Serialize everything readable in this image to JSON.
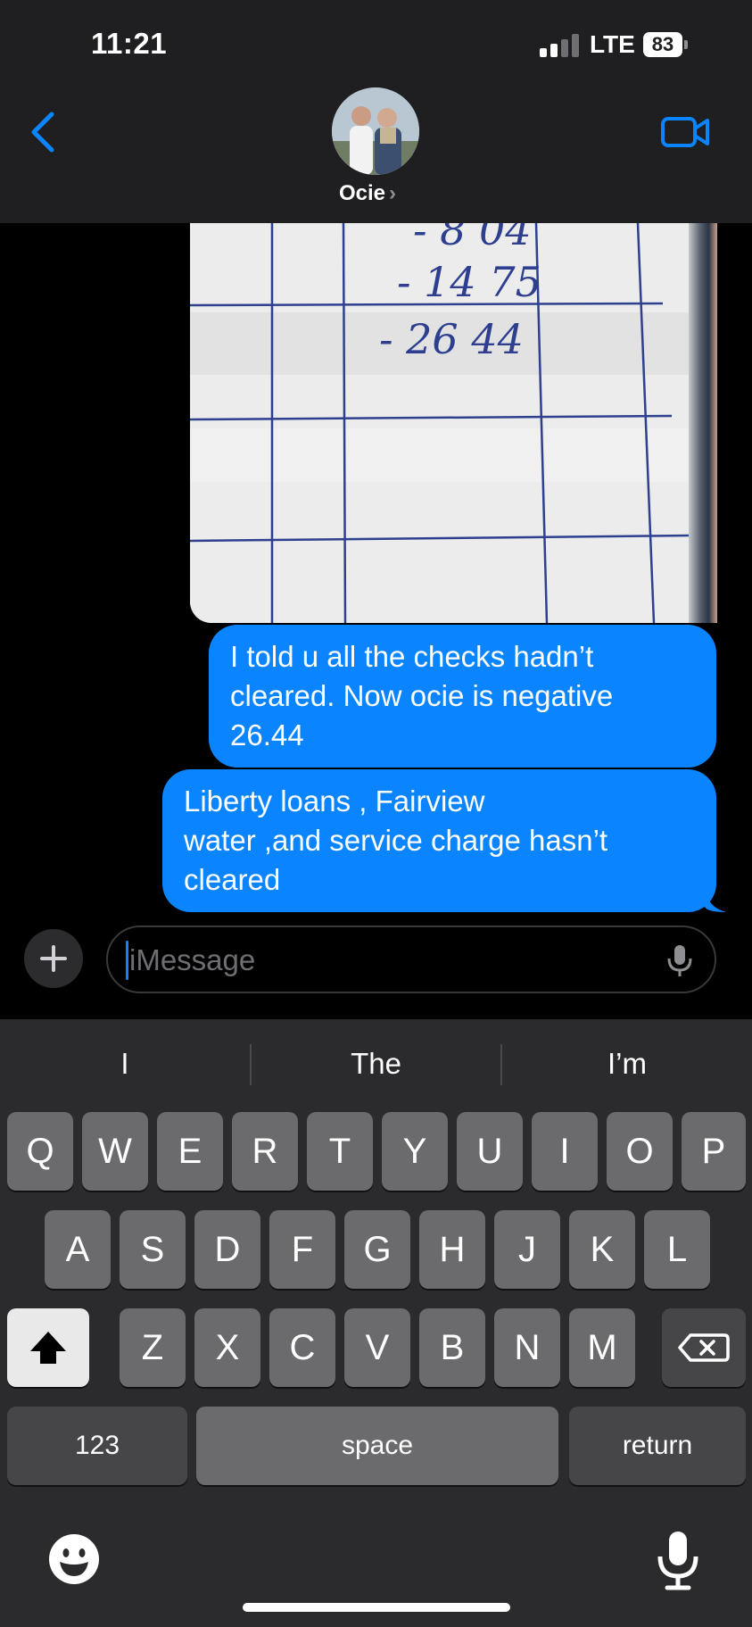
{
  "status_bar": {
    "time": "11:21",
    "network": "LTE",
    "battery": "83"
  },
  "header": {
    "contact_name": "Ocie",
    "chevron": "›"
  },
  "photo_message": {
    "handwritten_lines": [
      "- 8 04",
      "- 14 75",
      "- 26 44"
    ]
  },
  "messages": [
    {
      "text": "I told u all the checks hadn’t\ncleared.  Now ocie is negative\n26.44",
      "sender": "me"
    },
    {
      "text": "Liberty loans , Fairview\nwater ,and service charge hasn’t\ncleared",
      "sender": "me"
    }
  ],
  "composer": {
    "placeholder": "iMessage",
    "value": ""
  },
  "keyboard": {
    "suggestions": [
      "I",
      "The",
      "I’m"
    ],
    "row1": [
      "Q",
      "W",
      "E",
      "R",
      "T",
      "Y",
      "U",
      "I",
      "O",
      "P"
    ],
    "row2": [
      "A",
      "S",
      "D",
      "F",
      "G",
      "H",
      "J",
      "K",
      "L"
    ],
    "row3": [
      "Z",
      "X",
      "C",
      "V",
      "B",
      "N",
      "M"
    ],
    "numbers_label": "123",
    "space_label": "space",
    "return_label": "return"
  },
  "colors": {
    "bubble": "#0a84ff",
    "accent": "#0a84ff",
    "background": "#000000",
    "keyboard": "#2b2b2d"
  },
  "icons": [
    "back-chevron-icon",
    "video-camera-icon",
    "plus-icon",
    "microphone-icon",
    "shift-icon",
    "backspace-icon",
    "emoji-icon",
    "dictation-mic-icon"
  ]
}
